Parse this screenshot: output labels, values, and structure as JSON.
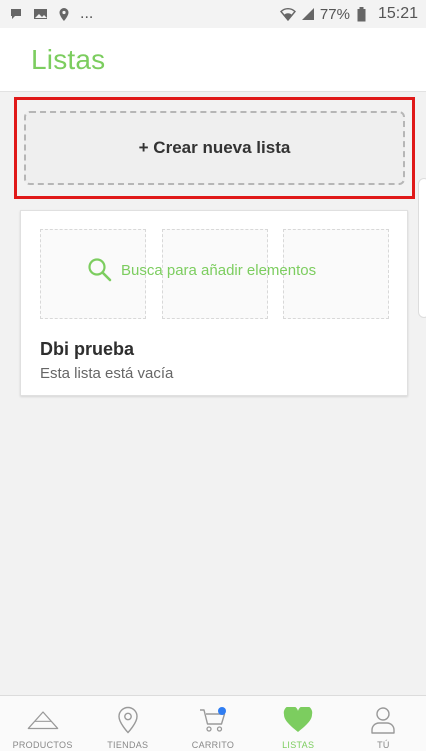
{
  "status_bar": {
    "ellipsis": "...",
    "battery": "77%",
    "time": "15:21"
  },
  "header": {
    "title": "Listas"
  },
  "create_button": {
    "label": "+ Crear nueva lista"
  },
  "list_card": {
    "search_hint": "Busca para añadir elementos",
    "title": "Dbi prueba",
    "subtitle": "Esta lista está vacía"
  },
  "bottom_nav": {
    "items": [
      {
        "label": "PRODUCTOS",
        "icon": "triangle-icon"
      },
      {
        "label": "TIENDAS",
        "icon": "map-pin-icon"
      },
      {
        "label": "CARRITO",
        "icon": "cart-icon"
      },
      {
        "label": "LISTAS",
        "icon": "heart-icon"
      },
      {
        "label": "TÚ",
        "icon": "user-icon"
      }
    ],
    "active_index": 3
  },
  "colors": {
    "accent": "#7ccd5f",
    "highlight_border": "#e01919",
    "notification_dot": "#2f7df2"
  }
}
